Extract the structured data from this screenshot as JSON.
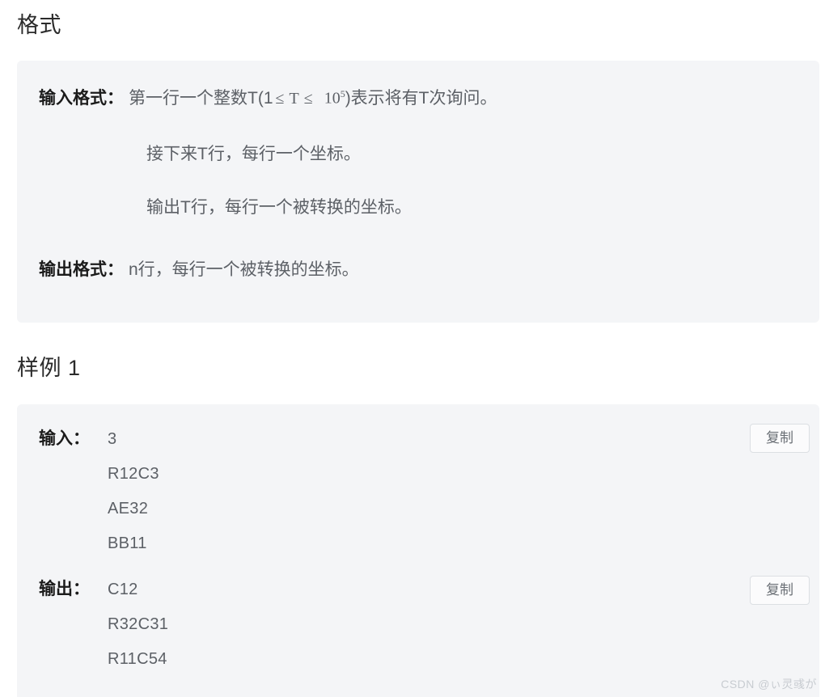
{
  "sections": {
    "format": {
      "title": "格式",
      "input_label": "输入格式：",
      "input_text_before": "第一行一个整数T(1",
      "le_symbol_1": "≤",
      "variable_t": "T",
      "le_symbol_2": "≤",
      "bound_base": "10",
      "bound_exp": "5",
      "input_text_after": ")表示将有T次询问。",
      "line2": "接下来T行，每行一个坐标。",
      "line3": "输出T行，每行一个被转换的坐标。",
      "output_label": "输出格式：",
      "output_text": "n行，每行一个被转换的坐标。"
    },
    "sample": {
      "title": "样例 1",
      "input_label": "输入：",
      "input_lines": [
        "3",
        "R12C3",
        "AE32",
        "BB11"
      ],
      "output_label": "输出：",
      "output_lines": [
        "C12",
        "R32C31",
        "R11C54"
      ],
      "copy_label": "复制"
    }
  },
  "watermark": "CSDN @ぃ灵彧が",
  "colors": {
    "panel_bg": "#f4f5f7",
    "page_bg": "#ffffff",
    "label_text": "#1b1b1b",
    "body_text": "#5c6066",
    "button_border": "#dcdfe3",
    "watermark_text": "#c8ccd1"
  }
}
